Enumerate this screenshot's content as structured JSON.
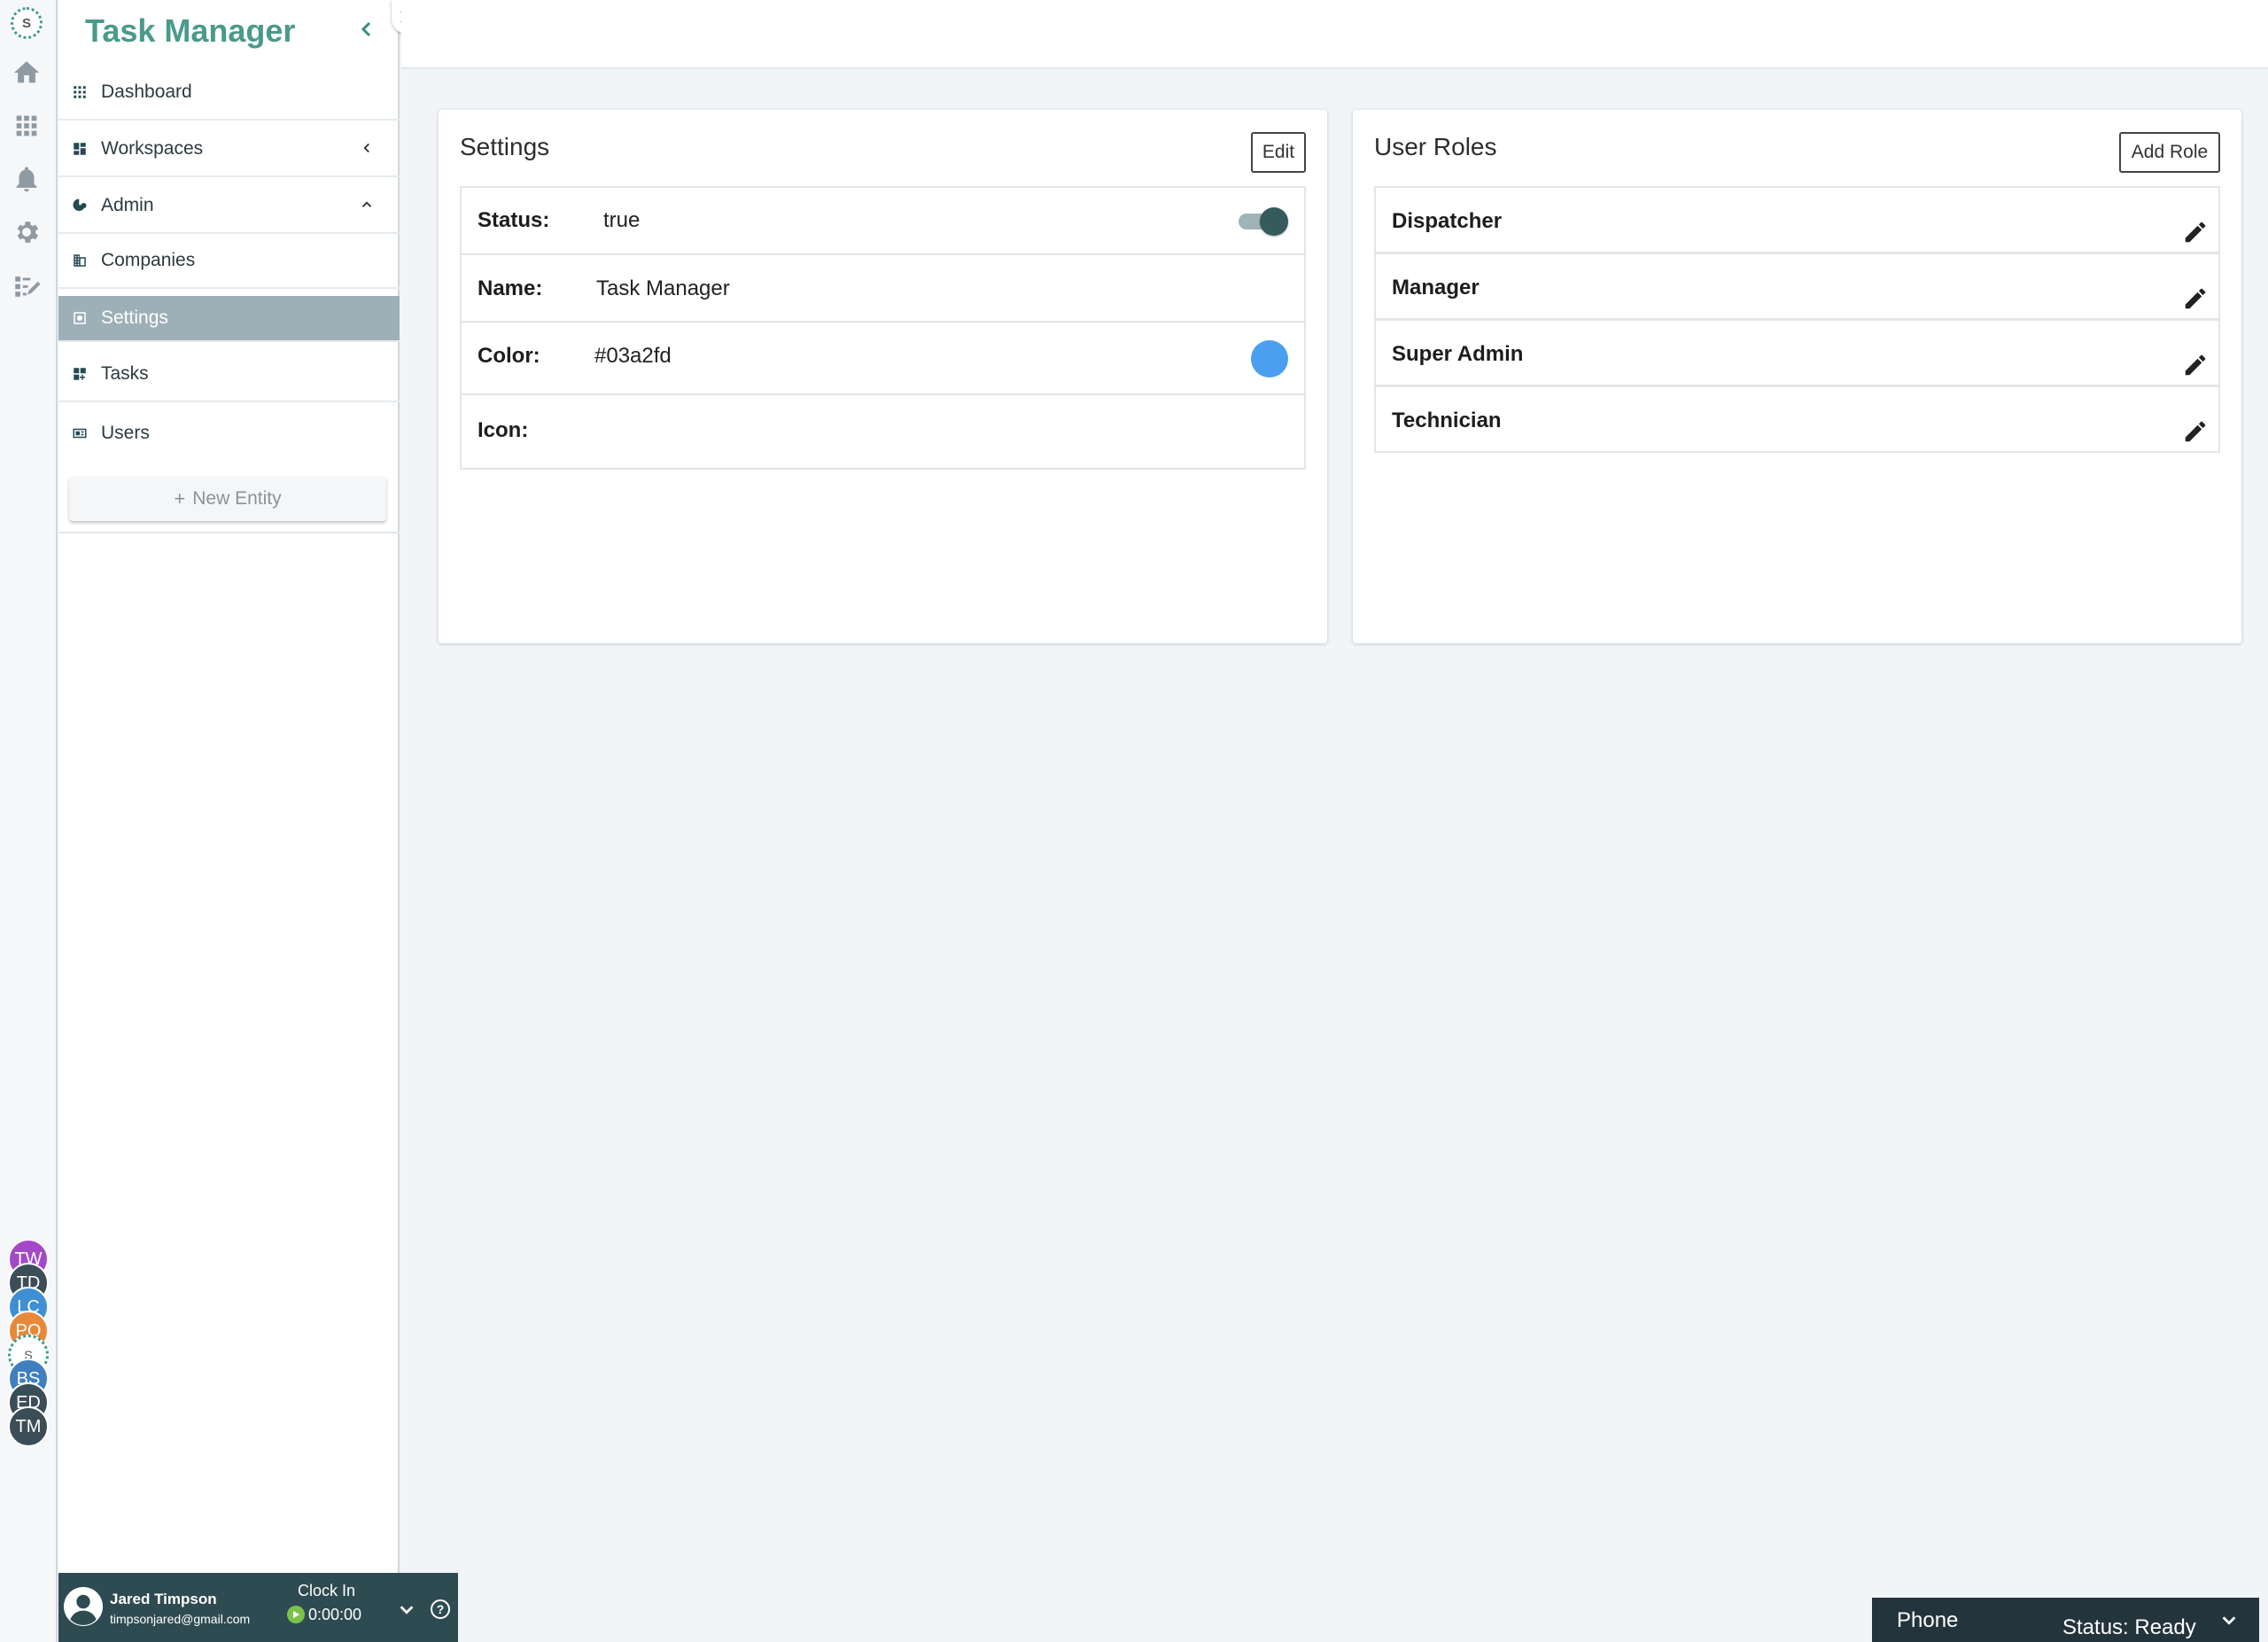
{
  "app": {
    "title": "Task Manager"
  },
  "rail": {
    "logo": "S",
    "icons": [
      "home-icon",
      "apps-grid-icon",
      "bell-icon",
      "gear-icon",
      "checklist-icon"
    ],
    "avatars": [
      {
        "initials": "TW",
        "color": "#a349c7"
      },
      {
        "initials": "TD",
        "color": "#3b4d57"
      },
      {
        "initials": "LC",
        "color": "#3f8fd4"
      },
      {
        "initials": "PO",
        "color": "#e8893a"
      },
      {
        "initials": "S",
        "color": "#ffffff"
      },
      {
        "initials": "BS",
        "color": "#3f7fc0"
      },
      {
        "initials": "ED",
        "color": "#3b4d57"
      },
      {
        "initials": "TM",
        "color": "#3b4d57"
      }
    ]
  },
  "sidebar": {
    "items": [
      {
        "label": "Dashboard",
        "icon": "grid-dots-icon"
      },
      {
        "label": "Workspaces",
        "icon": "dashboard-icon"
      },
      {
        "label": "Admin",
        "icon": "admin-icon"
      },
      {
        "label": "Companies",
        "icon": "building-icon"
      },
      {
        "label": "Settings",
        "icon": "settings-square-icon"
      },
      {
        "label": "Tasks",
        "icon": "tasks-grid-icon"
      },
      {
        "label": "Users",
        "icon": "id-card-icon"
      }
    ],
    "active": "Settings",
    "new_entity_label": "New Entity"
  },
  "user": {
    "name": "Jared Timpson",
    "email": "timpsonjared@gmail.com",
    "clock_label": "Clock In",
    "clock_time": "0:00:00",
    "help_glyph": "?"
  },
  "settings": {
    "title": "Settings",
    "edit_label": "Edit",
    "rows": {
      "status": {
        "label": "Status:",
        "value": "true",
        "toggle_on": true
      },
      "name": {
        "label": "Name:",
        "value": "Task Manager"
      },
      "color": {
        "label": "Color:",
        "value": "#03a2fd",
        "swatch": "#4a9ff0"
      },
      "icon": {
        "label": "Icon:",
        "value": ""
      }
    }
  },
  "roles": {
    "title": "User Roles",
    "add_label": "Add Role",
    "items": [
      "Dispatcher",
      "Manager",
      "Super Admin",
      "Technician"
    ]
  },
  "phone": {
    "label": "Phone",
    "status": "Status: Ready"
  },
  "colors": {
    "accent": "#4a9a8a",
    "sidebar_active": "#9eb0b7",
    "footer": "#2f4b52"
  }
}
